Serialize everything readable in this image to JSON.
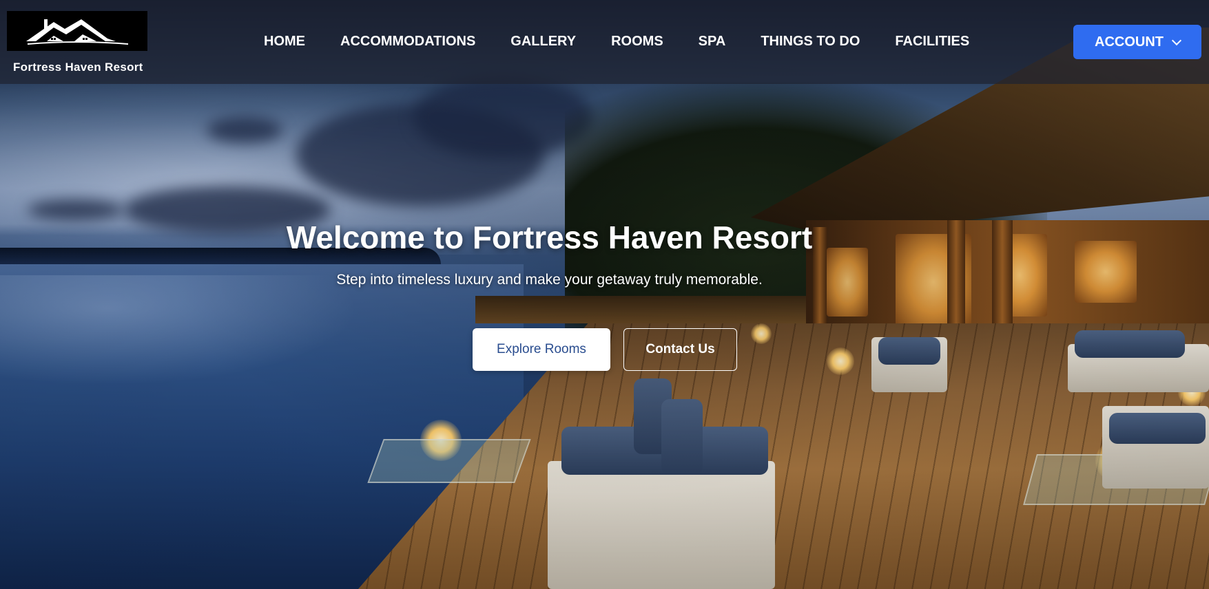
{
  "brand": {
    "name": "Fortress Haven Resort",
    "logo_icon": "house-roof-logo"
  },
  "nav": {
    "items": [
      {
        "label": "HOME"
      },
      {
        "label": "ACCOMMODATIONS"
      },
      {
        "label": "GALLERY"
      },
      {
        "label": "ROOMS"
      },
      {
        "label": "SPA"
      },
      {
        "label": "THINGS TO DO"
      },
      {
        "label": "FACILITIES"
      }
    ]
  },
  "account": {
    "label": "ACCOUNT",
    "icon": "chevron-down-icon",
    "color": "#2f6cf0"
  },
  "hero": {
    "title": "Welcome to Fortress Haven Resort",
    "subtitle": "Step into timeless luxury and make your getaway truly memorable.",
    "primary_button": "Explore Rooms",
    "secondary_button": "Contact Us",
    "background": "overwater-villa-deck-at-dusk"
  }
}
